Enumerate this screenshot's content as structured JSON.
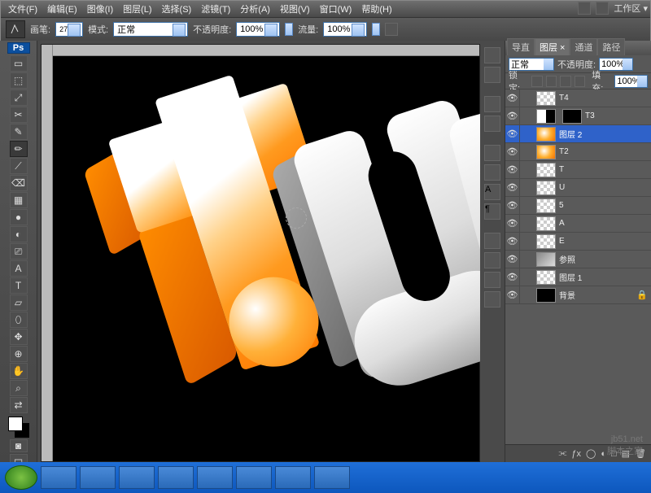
{
  "menu": {
    "items": [
      "文件(F)",
      "编辑(E)",
      "图像(I)",
      "图层(L)",
      "选择(S)",
      "滤镜(T)",
      "分析(A)",
      "视图(V)",
      "窗口(W)",
      "帮助(H)"
    ]
  },
  "options": {
    "brush_label": "画笔:",
    "brush_size": "27",
    "mode_label": "模式:",
    "mode_value": "正常",
    "opacity_label": "不透明度:",
    "opacity_value": "100%",
    "flow_label": "流量:",
    "flow_value": "100%",
    "workspace_label": "工作区 ▾"
  },
  "layersPanel": {
    "tabs": [
      "导直",
      "图层 ×",
      "通道",
      "路径"
    ],
    "blend_label": "正常",
    "opacity_label": "不透明度:",
    "opacity_value": "100%",
    "lock_label": "锁定:",
    "fill_label": "填充:",
    "fill_value": "100%",
    "layers": [
      {
        "name": "T4",
        "thumb": "checker",
        "masked": false
      },
      {
        "name": "T3",
        "thumb": "mix",
        "masked": true
      },
      {
        "name": "图层 2",
        "thumb": "orange",
        "masked": false,
        "selected": true
      },
      {
        "name": "T2",
        "thumb": "orange",
        "masked": false
      },
      {
        "name": "T",
        "thumb": "checker",
        "masked": false
      },
      {
        "name": "U",
        "thumb": "checker",
        "masked": false
      },
      {
        "name": "5",
        "thumb": "checker",
        "masked": false
      },
      {
        "name": "A",
        "thumb": "checker",
        "masked": false
      },
      {
        "name": "E",
        "thumb": "checker",
        "masked": false
      },
      {
        "name": "参照",
        "thumb": "ref",
        "masked": false
      },
      {
        "name": "图层 1",
        "thumb": "checker",
        "masked": false
      },
      {
        "name": "背景",
        "thumb": "black",
        "masked": false,
        "locked": true
      }
    ]
  },
  "swatch": {
    "fg": "#ffffff",
    "bg": "#000000"
  },
  "watermark": {
    "line1": "jb51.net",
    "line2": "脚本之家"
  },
  "tools": [
    "▭",
    "⬚",
    "⤢",
    "✂",
    "✎",
    "✏",
    "⟋",
    "⌫",
    "▦",
    "●",
    "◐",
    "⎚",
    "A",
    "T",
    "▱",
    "⬯",
    "✥",
    "⊕",
    "✋",
    "⌕",
    "⇄"
  ]
}
